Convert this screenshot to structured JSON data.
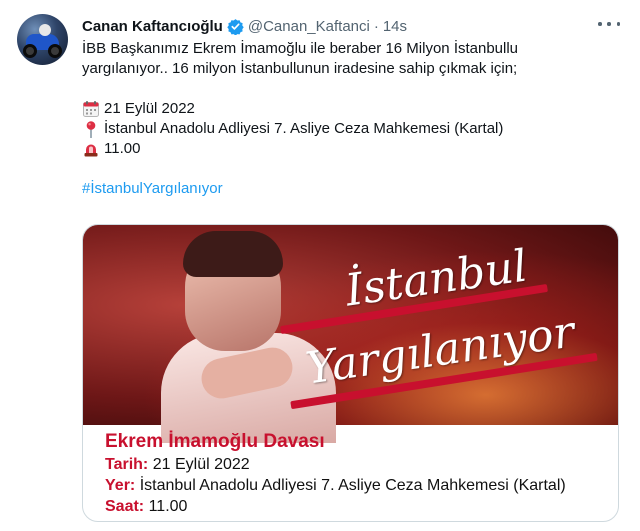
{
  "tweet": {
    "author_name": "Canan Kaftancıoğlu",
    "author_handle": "@Canan_Kaftanci",
    "separator": "·",
    "time": "14s",
    "text_line1": "İBB Başkanımız Ekrem İmamoğlu ile beraber 16 Milyon İstanbullu",
    "text_line2": "yargılanıyor.. 16 milyon İstanbullunun iradesine sahip çıkmak için;",
    "date_line": "21 Eylül 2022",
    "place_line": "İstanbul Anadolu Adliyesi 7. Asliye Ceza Mahkemesi (Kartal)",
    "time_line": "11.00",
    "hashtag": "#İstanbulYargılanıyor"
  },
  "card": {
    "script_line1": "İstanbul",
    "script_line2": "Yargılanıyor",
    "title": "Ekrem İmamoğlu Davası",
    "date_label": "Tarih:",
    "date_value": "21 Eylül 2022",
    "place_label": "Yer:",
    "place_value": "İstanbul Anadolu Adliyesi 7. Asliye Ceza Mahkemesi (Kartal)",
    "time_label": "Saat:",
    "time_value": "11.00"
  },
  "icons": {
    "verified": "verified-badge-icon",
    "more": "more-options-icon",
    "calendar": "calendar-emoji-icon",
    "pin": "round-pushpin-emoji-icon",
    "alarm": "rotating-light-emoji-icon"
  },
  "colors": {
    "accent_blue": "#1d9bf0",
    "secondary_text": "#536471",
    "card_red": "#c8102e"
  }
}
